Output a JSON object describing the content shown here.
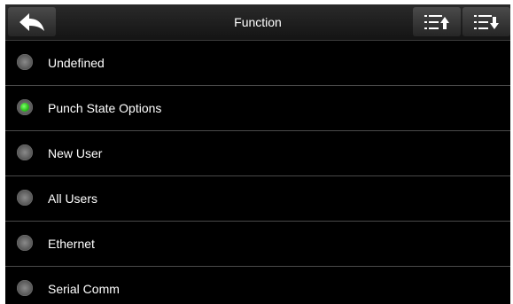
{
  "header": {
    "title": "Function",
    "back_icon": "back-arrow-icon",
    "sort_up_icon": "list-sort-up-icon",
    "sort_down_icon": "list-sort-down-icon"
  },
  "options": [
    {
      "label": "Undefined",
      "selected": false
    },
    {
      "label": "Punch State Options",
      "selected": true
    },
    {
      "label": "New User",
      "selected": false
    },
    {
      "label": "All Users",
      "selected": false
    },
    {
      "label": "Ethernet",
      "selected": false
    },
    {
      "label": "Serial Comm",
      "selected": false
    }
  ],
  "colors": {
    "background": "#000000",
    "selected_indicator": "#2fc21f",
    "text": "#ffffff"
  }
}
